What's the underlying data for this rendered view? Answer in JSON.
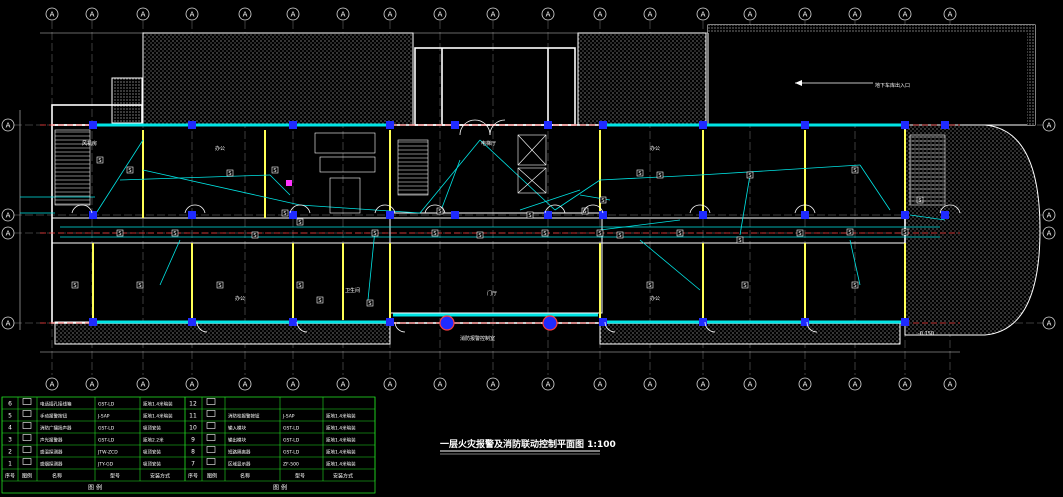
{
  "drawing": {
    "title": "一层火灾报警及消防联动控制平面图 1:100",
    "colors": {
      "background": "#000000",
      "wall": "#ffffff",
      "axis": "#d9d9d9",
      "column": "#1f2bff",
      "wiring": "#00e5e5",
      "partition": "#ffff55",
      "legend_grid": "#22dd22",
      "axis_dash": "#ff3b3b",
      "hatch": "#bbbbbb",
      "accent": "#ff33ff"
    }
  },
  "axes": {
    "label": "A",
    "top_count": 17,
    "bottom_count": 17,
    "left_count": 4,
    "right_count": 4
  },
  "plan_labels": {
    "elevator_hall": "电梯厅",
    "main_hall": "门厅",
    "office": "办公",
    "stair": "楼梯",
    "toilet": "卫生间",
    "entrance_note": "地下车库出入口",
    "smoke_note": "消防报警控制室",
    "level_mark": "-0.150",
    "fan_room": "风机房"
  },
  "legend": {
    "header": [
      "序号",
      "图例",
      "名称",
      "型号",
      "安装方式"
    ],
    "footer_left": "图 例",
    "footer_right": "图 例",
    "rows_left": [
      {
        "no": "6",
        "name": "电话插孔接线箱",
        "model": "GST-LD",
        "install": "距地1.4米暗装"
      },
      {
        "no": "5",
        "name": "手动报警按钮",
        "model": "J-SAP",
        "install": "距地1.4米暗装"
      },
      {
        "no": "4",
        "name": "消防广播扬声器",
        "model": "GST-LD",
        "install": "吸顶安装"
      },
      {
        "no": "3",
        "name": "声光报警器",
        "model": "GST-LD",
        "install": "距地2.2米"
      },
      {
        "no": "2",
        "name": "感温探测器",
        "model": "JTW-ZCD",
        "install": "吸顶安装"
      },
      {
        "no": "1",
        "name": "感烟探测器",
        "model": "JTY-GD",
        "install": "吸顶安装"
      }
    ],
    "rows_right": [
      {
        "no": "12",
        "name": "",
        "model": "",
        "install": ""
      },
      {
        "no": "11",
        "name": "消防栓报警按钮",
        "model": "J-SAP",
        "install": "距地1.4米暗装"
      },
      {
        "no": "10",
        "name": "输入模块",
        "model": "GST-LD",
        "install": "距地1.4米暗装"
      },
      {
        "no": "9",
        "name": "输出模块",
        "model": "GST-LD",
        "install": "距地1.4米暗装"
      },
      {
        "no": "8",
        "name": "短路隔离器",
        "model": "GST-LD",
        "install": "距地1.4米暗装"
      },
      {
        "no": "7",
        "name": "区域显示器",
        "model": "ZF-500",
        "install": "距地1.4米暗装"
      }
    ]
  }
}
